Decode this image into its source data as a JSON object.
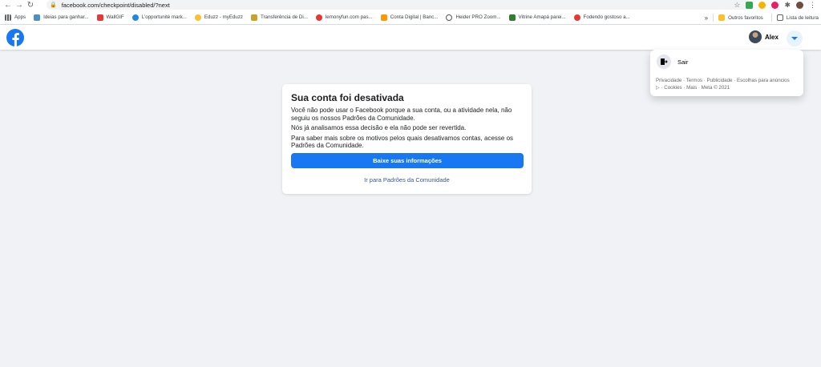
{
  "browser": {
    "url": "facebook.com/checkpoint/disabled/?next",
    "bookmarks": [
      {
        "label": "Apps",
        "color": "#5f6368"
      },
      {
        "label": "Ideias para ganhar...",
        "color": "#4a90c2"
      },
      {
        "label": "WallGIF",
        "color": "#e53935"
      },
      {
        "label": "L'opportunité mark...",
        "color": "#1e88e5"
      },
      {
        "label": "Eduzz - myEduzz",
        "color": "#fbc02d"
      },
      {
        "label": "Transferência de Di...",
        "color": "#c9a227"
      },
      {
        "label": "lemonyfun.com pas...",
        "color": "#e53935"
      },
      {
        "label": "Conta Digital | Banc...",
        "color": "#ff9800"
      },
      {
        "label": "Heider PRO Zoom...",
        "color": "#555555"
      },
      {
        "label": "Vitrine Amapá parei...",
        "color": "#2e7d32"
      },
      {
        "label": "Fodendo gostoso a...",
        "color": "#e53935"
      }
    ],
    "more_label": "»",
    "other_favorites": "Outros favoritos",
    "reading_list": "Lista de leitura"
  },
  "header": {
    "profile_name": "Alex"
  },
  "dropdown": {
    "logout_label": "Sair",
    "footer_links": "Privacidade · Termos · Publicidade · Escolhas para anúncios ▷ · Cookies · Mais · Meta © 2021"
  },
  "card": {
    "title": "Sua conta foi desativada",
    "paragraph1": "Você não pode usar o Facebook porque a sua conta, ou a atividade nela, não seguiu os nossos Padrões da Comunidade.",
    "paragraph2": "Nós já analisamos essa decisão e ela não pode ser revertida.",
    "paragraph3": "Para saber mais sobre os motivos pelos quais desativamos contas, acesse os Padrões da Comunidade.",
    "primary_button": "Baixe suas informações",
    "secondary_link": "Ir para Padrões da Comunidade"
  },
  "colors": {
    "brand": "#1877f2",
    "link": "#385898",
    "background": "#f0f2f5"
  }
}
